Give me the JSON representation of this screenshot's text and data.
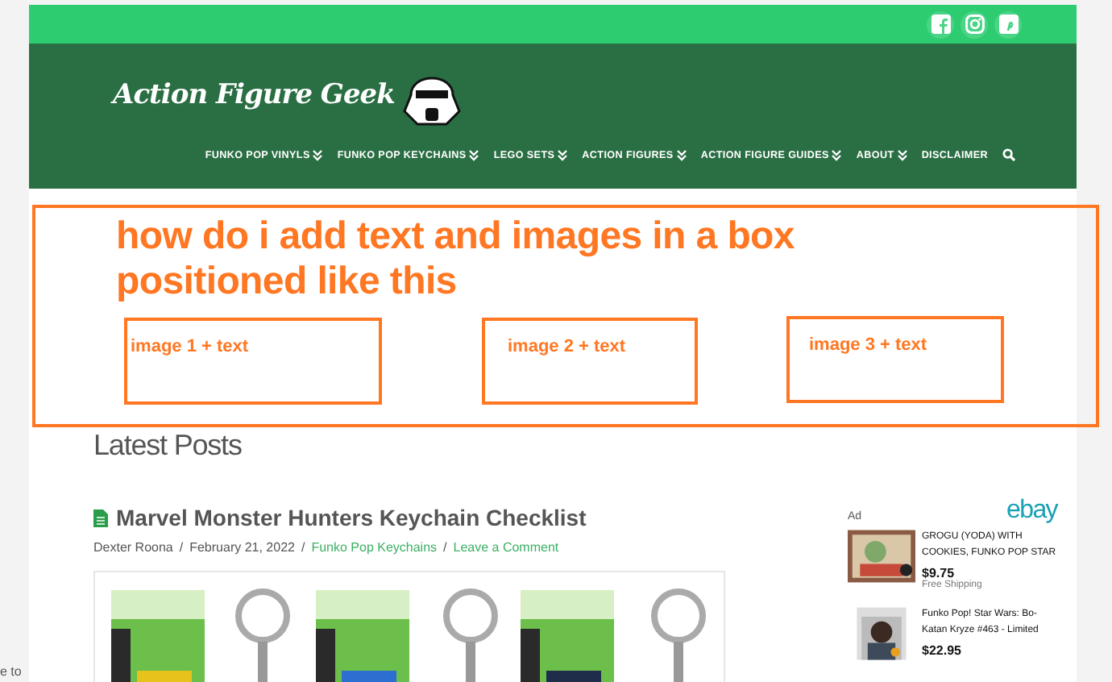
{
  "site": {
    "title": "Action Figure Geek",
    "social": [
      {
        "kind": "facebook"
      },
      {
        "kind": "instagram"
      },
      {
        "kind": "pinterest"
      }
    ],
    "nav": [
      {
        "label": "FUNKO POP VINYLS",
        "dropdown": true
      },
      {
        "label": "FUNKO POP KEYCHAINS",
        "dropdown": true
      },
      {
        "label": "LEGO SETS",
        "dropdown": true
      },
      {
        "label": "ACTION FIGURES",
        "dropdown": true
      },
      {
        "label": "ACTION FIGURE GUIDES",
        "dropdown": true
      },
      {
        "label": "ABOUT",
        "dropdown": true
      },
      {
        "label": "DISCLAIMER",
        "dropdown": false
      }
    ]
  },
  "annotation": {
    "question": "how do i add text and images in a box positioned like this",
    "boxes": [
      "image 1 + text",
      "image 2 + text",
      "image 3 + text"
    ]
  },
  "main": {
    "heading": "Latest Posts",
    "post": {
      "title": "Marvel Monster Hunters Keychain Checklist",
      "author": "Dexter Roona",
      "date": "February 21, 2022",
      "category": "Funko Pop Keychains",
      "comment_link": "Leave a Comment",
      "separators": [
        "/",
        "/",
        "/"
      ]
    }
  },
  "sidebar": {
    "ad_label": "Ad",
    "brand": "ebay",
    "products": [
      {
        "title": "GROGU (YODA) WITH COOKIES, FUNKO POP STAR",
        "price": "$9.75",
        "shipping": "Free Shipping"
      },
      {
        "title": "Funko Pop! Star Wars: Bo-Katan Kryze #463 - Limited",
        "price": "$22.95"
      }
    ]
  },
  "left_edge": {
    "text": "e to"
  }
}
